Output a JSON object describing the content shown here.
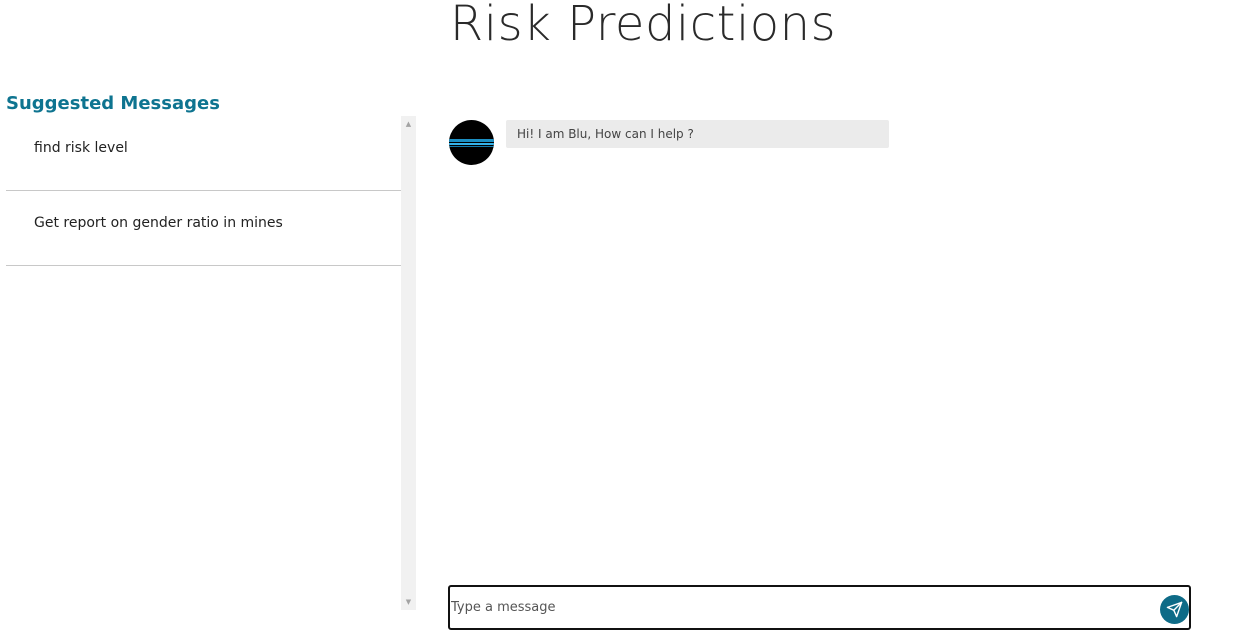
{
  "header": {
    "title": "Risk Predictions"
  },
  "suggestions": {
    "heading": "Suggested Messages",
    "items": [
      {
        "label": "find risk level"
      },
      {
        "label": "Get report on gender ratio in mines"
      }
    ]
  },
  "chat": {
    "messages": [
      {
        "sender": "bot",
        "text": "Hi! I am Blu, How can I help ?"
      }
    ],
    "input": {
      "value": "",
      "placeholder": "Type a message"
    },
    "send_icon": "paper-plane-icon"
  },
  "colors": {
    "accent": "#0e7490",
    "send_button": "#0e6b87",
    "bubble_bg": "#ebebeb"
  }
}
